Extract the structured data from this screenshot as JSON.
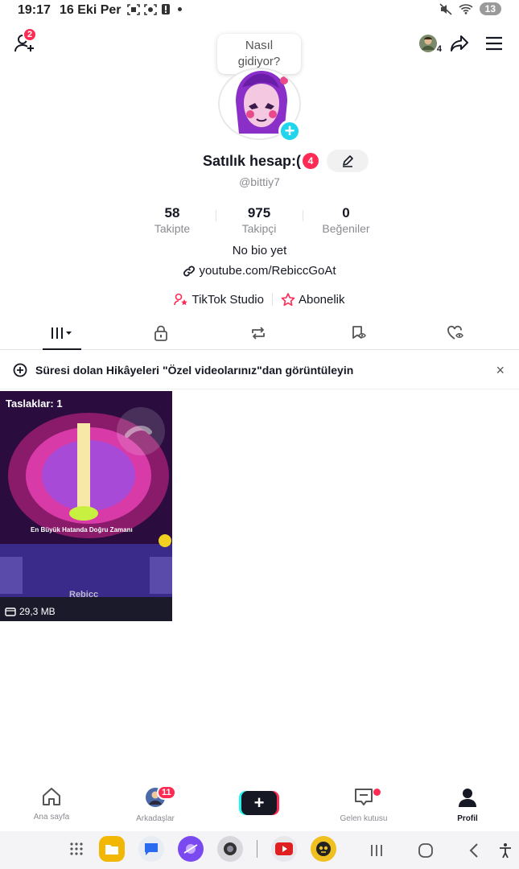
{
  "status_bar": {
    "time": "19:17",
    "date": "16 Eki Per",
    "battery": "13"
  },
  "header": {
    "add_friends_badge": "2",
    "avatar_badge": "4"
  },
  "bubble": {
    "text": "Nasıl gidiyor?"
  },
  "profile": {
    "name": "Satılık hesap:(",
    "name_badge": "4",
    "handle": "@bittiy7",
    "bio": "No bio yet",
    "link": "youtube.com/RebiccGoAt"
  },
  "stats": [
    {
      "value": "58",
      "label": "Takipte"
    },
    {
      "value": "975",
      "label": "Takipçi"
    },
    {
      "value": "0",
      "label": "Beğeniler"
    }
  ],
  "actions": {
    "studio": "TikTok Studio",
    "subscription": "Abonelik"
  },
  "notice": {
    "text": "Süresi dolan Hikâyeleri \"Özel videolarınız\"dan görüntüleyin",
    "close": "×"
  },
  "draft": {
    "label": "Taslaklar: 1",
    "size": "29,3 MB",
    "caption": "En Büyük Hatanda Doğru Zamanı",
    "watermark": "Rebicc"
  },
  "bottom_nav": {
    "home": "Ana sayfa",
    "friends": "Arkadaşlar",
    "friends_badge": "11",
    "inbox": "Gelen kutusu",
    "profile": "Profil"
  },
  "colors": {
    "accent": "#fe2c55",
    "cyan": "#20d5ec",
    "text": "#161823",
    "muted": "#8a8b91"
  }
}
